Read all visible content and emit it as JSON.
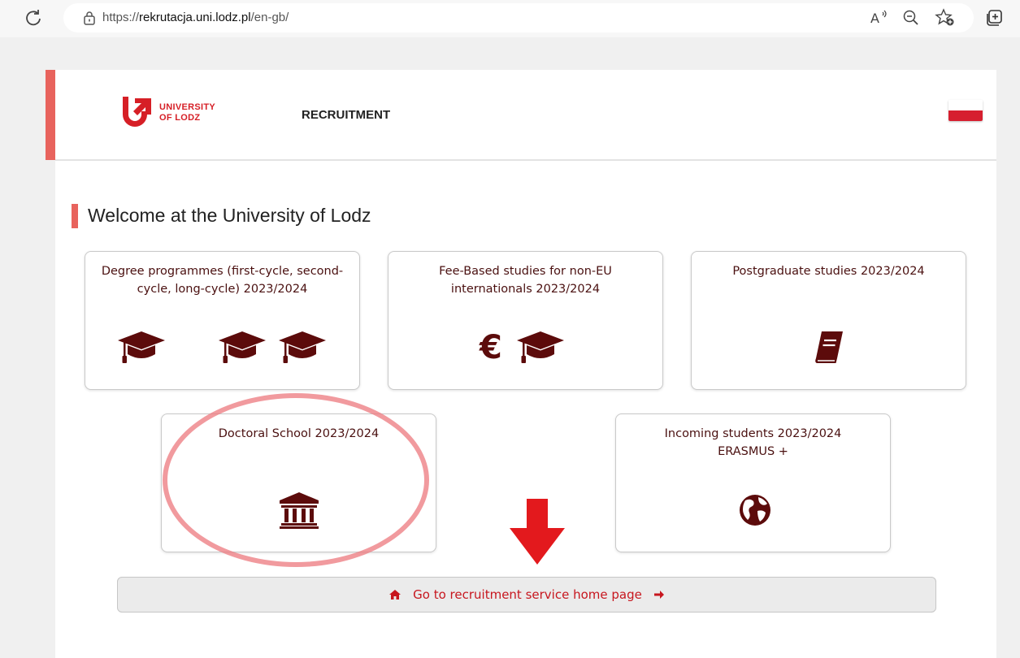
{
  "browser": {
    "url_prefix": "https://",
    "url_host": "rekrutacja.uni.lodz.pl",
    "url_path": "/en-gb/",
    "read_aloud_label": "Ă"
  },
  "header": {
    "logo_line1": "UNIVERSITY",
    "logo_line2": "OF LODZ",
    "nav_label": "RECRUITMENT",
    "language": "Polish flag"
  },
  "main": {
    "title": "Welcome at the University of Lodz",
    "cards": [
      {
        "title": "Degree programmes (first-cycle, second-cycle, long-cycle) 2023/2024",
        "icons": [
          "graduation-cap-icon",
          "graduation-cap-icon",
          "graduation-cap-icon"
        ]
      },
      {
        "title": "Fee-Based studies for non-EU internationals 2023/2024",
        "icons": [
          "euro-icon",
          "graduation-cap-icon"
        ]
      },
      {
        "title": "Postgraduate studies 2023/2024",
        "icons": [
          "book-icon"
        ]
      },
      {
        "title": "Doctoral School 2023/2024",
        "icons": [
          "university-building-icon"
        ]
      },
      {
        "title_line1": "Incoming students 2023/2024",
        "title_line2": "ERASMUS +",
        "icons": [
          "globe-icon"
        ]
      }
    ],
    "home_link": "Go to recruitment service home page"
  },
  "colors": {
    "accent": "#e8635d",
    "brand_red": "#d61f26",
    "icon_dark_red": "#5c0b0b",
    "link_red": "#c7161e",
    "annotation": "#ec787e"
  }
}
